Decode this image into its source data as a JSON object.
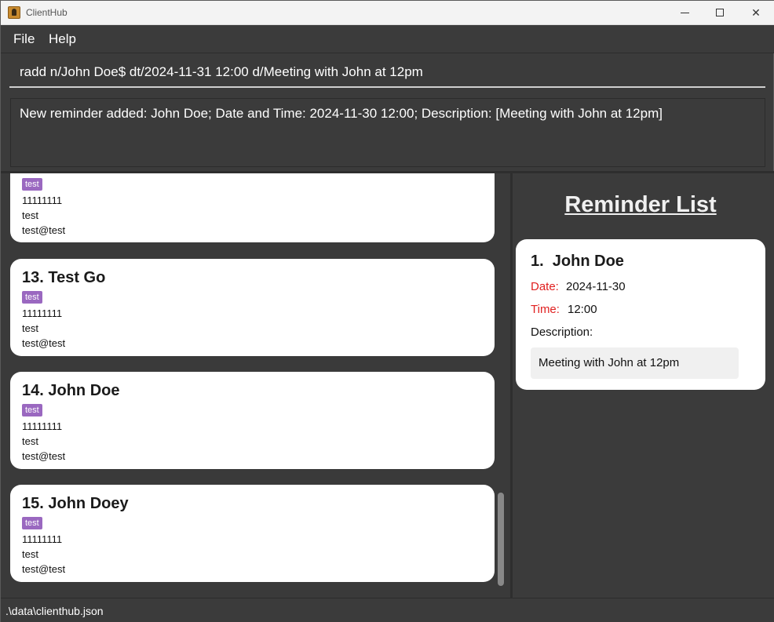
{
  "window": {
    "title": "ClientHub",
    "minimize_icon": "minimize-icon",
    "maximize_icon": "maximize-icon",
    "close_glyph": "✕"
  },
  "menu": {
    "file": "File",
    "help": "Help"
  },
  "command": {
    "value": "radd n/John Doe$ dt/2024-11-31 12:00 d/Meeting with John at 12pm"
  },
  "result": {
    "text": "New reminder added: John Doe; Date and Time: 2024-11-30 12:00; Description: [Meeting with John at 12pm]"
  },
  "persons": [
    {
      "name": "",
      "tag": "test",
      "phone": "11111111",
      "address": "test",
      "email": "test@test"
    },
    {
      "name": "13. Test Go",
      "tag": "test",
      "phone": "11111111",
      "address": "test",
      "email": "test@test"
    },
    {
      "name": "14. John Doe",
      "tag": "test",
      "phone": "11111111",
      "address": "test",
      "email": "test@test"
    },
    {
      "name": "15. John Doey",
      "tag": "test",
      "phone": "11111111",
      "address": "test",
      "email": "test@test"
    }
  ],
  "reminders": {
    "title": "Reminder List",
    "items": [
      {
        "name": "1.  John Doe",
        "date_label": "Date:",
        "date": "2024-11-30",
        "time_label": "Time:",
        "time": "12:00",
        "description_label": "Description:",
        "description": "Meeting with John at 12pm"
      }
    ]
  },
  "status": {
    "path": ".\\data\\clienthub.json"
  },
  "colors": {
    "background": "#3b3b3b",
    "tag": "#9a68c0",
    "label_red": "#e02020"
  }
}
